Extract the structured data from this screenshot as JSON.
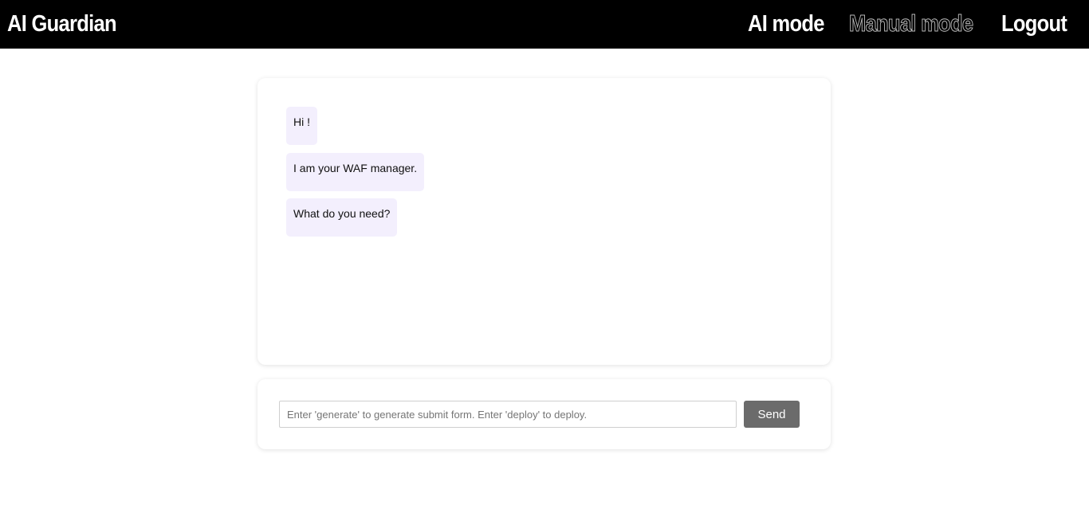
{
  "header": {
    "brand": "AI Guardian",
    "nav": {
      "ai_mode": "AI mode",
      "manual_mode": "Manual mode",
      "logout": "Logout"
    }
  },
  "chat": {
    "messages": [
      {
        "text": "Hi !"
      },
      {
        "text": "I am your WAF manager."
      },
      {
        "text": "What do you need?"
      }
    ]
  },
  "composer": {
    "input_value": "",
    "placeholder": "Enter 'generate' to generate submit form. Enter 'deploy' to deploy.",
    "send_label": "Send"
  },
  "colors": {
    "header_bg": "#000000",
    "message_bubble": "#f3effd",
    "send_button": "#6b6b6b"
  }
}
